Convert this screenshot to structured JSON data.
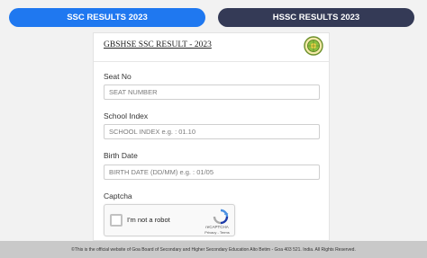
{
  "tabs": {
    "ssc_label": "SSC RESULTS 2023",
    "hssc_label": "HSSC RESULTS 2023"
  },
  "card": {
    "title": "GBSHSE SSC RESULT - 2023"
  },
  "form": {
    "seat_label": "Seat No",
    "seat_placeholder": "SEAT NUMBER",
    "school_label": "School Index",
    "school_placeholder": "SCHOOL INDEX e.g. : 01.10",
    "birth_label": "Birth Date",
    "birth_placeholder": "BIRTH DATE (DD/MM) e.g. : 01/05",
    "captcha_label": "Captcha"
  },
  "recaptcha": {
    "checkbox_label": "I'm not a robot",
    "brand": "reCAPTCHA",
    "links": "Privacy - Terms"
  },
  "footer": {
    "text": "©This is the official website of Goa Board of Secondary and Higher Secondary Education Alto Betim - Goa 403 521. India. All Rights Reserved."
  },
  "colors": {
    "ssc_tab": "#1f78f0",
    "hssc_tab": "#343a56",
    "footer_bg": "#c9c9c9"
  }
}
